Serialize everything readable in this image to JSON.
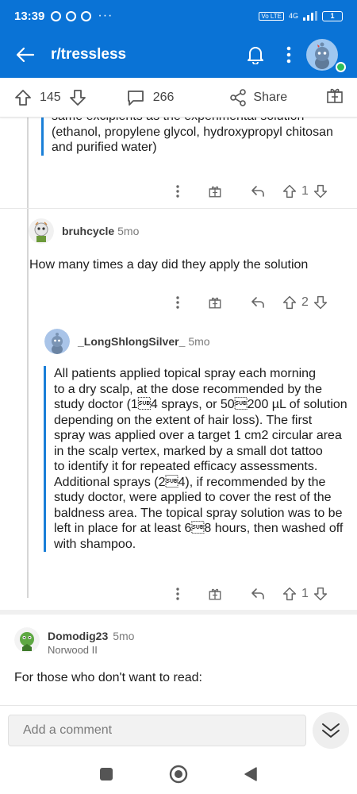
{
  "status_bar": {
    "time": "13:39",
    "more": "···",
    "network": "4G",
    "volte": "Vo LTE",
    "battery": "1"
  },
  "app_bar": {
    "title": "r/tressless"
  },
  "post_actions": {
    "upvotes": "145",
    "comments": "266",
    "share_label": "Share"
  },
  "comments": [
    {
      "quote_lines": [
        "same excipients as the experimental solution",
        "(ethanol, propylene glycol, hydroxypropyl chitosan",
        "and purified water)"
      ],
      "votes": "1"
    },
    {
      "username": "bruhcycle",
      "age": "5mo",
      "text": "How many times a day did they apply the solution",
      "votes": "2"
    },
    {
      "username": "_LongShlongSilver_",
      "age": "5mo",
      "quote_lines": [
        "All patients applied topical spray each morning",
        "to a dry scalp, at the dose recommended by the",
        "study doctor (1\u001a4 sprays, or 50\u001a200 µL of solution",
        "depending on the extent of hair loss). The first",
        "spray was applied over a target 1 cm2 circular area",
        "in the scalp vertex, marked by a small dot tattoo",
        "to identify it for repeated efficacy assessments.",
        "Additional sprays (2\u001a4), if recommended by the",
        "study doctor, were applied to cover the rest of the",
        "baldness area. The topical spray solution was to be",
        "left in place for at least 6\u001a8 hours, then washed off",
        "with shampoo."
      ],
      "votes": "1"
    },
    {
      "username": "Domodig23",
      "age": "5mo",
      "flair": "Norwood II",
      "text": "For those who don't want to read:"
    }
  ],
  "compose": {
    "placeholder": "Add a comment"
  },
  "colors": {
    "brand": "#0a73d6",
    "quote_bar": "#1a7fd8",
    "online": "#2ebd59"
  }
}
